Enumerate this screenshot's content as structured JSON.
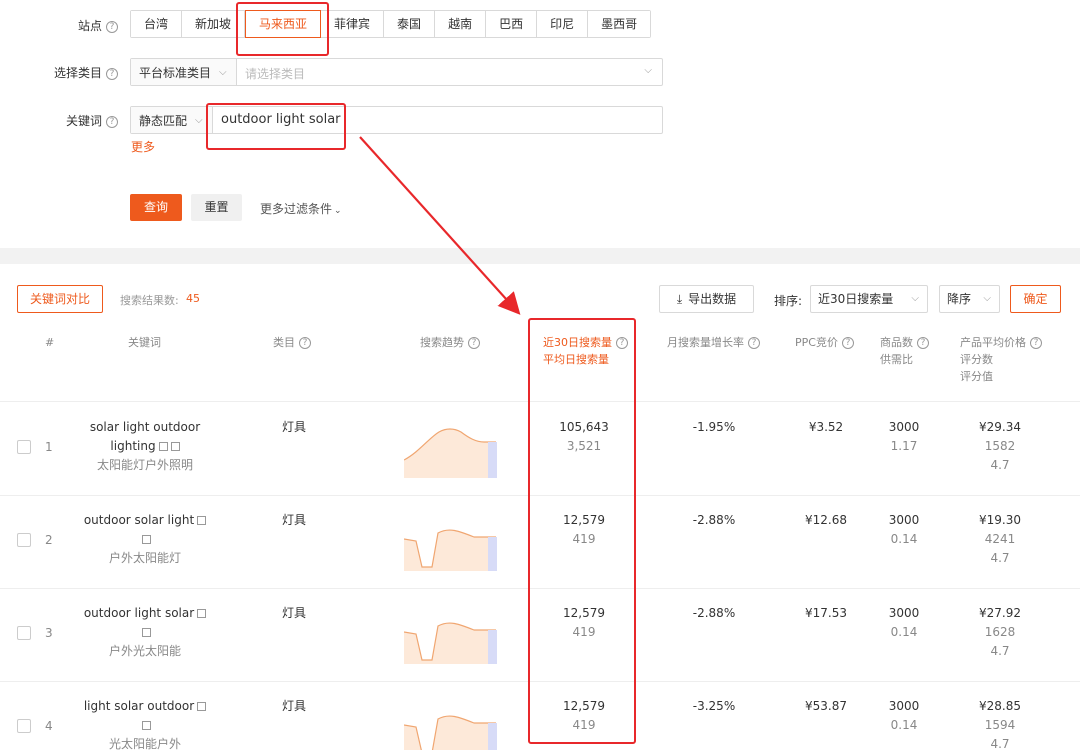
{
  "filters": {
    "site_label": "站点",
    "sites": [
      "台湾",
      "新加坡",
      "马来西亚",
      "菲律宾",
      "泰国",
      "越南",
      "巴西",
      "印尼",
      "墨西哥"
    ],
    "active_site": 2,
    "category_label": "选择类目",
    "category_type": "平台标准类目",
    "category_placeholder": "请选择类目",
    "keyword_label": "关键词",
    "match_type": "静态匹配",
    "keyword_value": "outdoor light solar",
    "more_label": "更多",
    "query_btn": "查询",
    "reset_btn": "重置",
    "more_filters": "更多过滤条件"
  },
  "toolbar": {
    "compare_btn": "关键词对比",
    "result_count_label": "搜索结果数:",
    "result_count": "45",
    "export_btn": "导出数据",
    "sort_label": "排序:",
    "sort_value": "近30日搜索量",
    "order_value": "降序",
    "confirm_btn": "确定"
  },
  "table": {
    "headers": {
      "num": "#",
      "keyword": "关键词",
      "category": "类目",
      "trend": "搜索趋势",
      "search30": "近30日搜索量",
      "search_daily": "平均日搜索量",
      "growth": "月搜索量增长率",
      "ppc": "PPC竞价",
      "products": "商品数",
      "supply_ratio": "供需比",
      "avg_price": "产品平均价格",
      "reviews": "评分数",
      "rating": "评分值"
    },
    "rows": [
      {
        "idx": "1",
        "kw1": "solar light outdoor",
        "kw2": "lighting",
        "cn": "太阳能灯户外照明",
        "cat": "灯具",
        "s30": "105,643",
        "daily": "3,521",
        "growth": "-1.95%",
        "ppc": "¥3.52",
        "products": "3000",
        "ratio": "1.17",
        "price": "¥29.34",
        "reviews": "1582",
        "rating": "4.7"
      },
      {
        "idx": "2",
        "kw1": "outdoor solar light",
        "kw2": "",
        "cn": "户外太阳能灯",
        "cat": "灯具",
        "s30": "12,579",
        "daily": "419",
        "growth": "-2.88%",
        "ppc": "¥12.68",
        "products": "3000",
        "ratio": "0.14",
        "price": "¥19.30",
        "reviews": "4241",
        "rating": "4.7"
      },
      {
        "idx": "3",
        "kw1": "outdoor light solar",
        "kw2": "",
        "cn": "户外光太阳能",
        "cat": "灯具",
        "s30": "12,579",
        "daily": "419",
        "growth": "-2.88%",
        "ppc": "¥17.53",
        "products": "3000",
        "ratio": "0.14",
        "price": "¥27.92",
        "reviews": "1628",
        "rating": "4.7"
      },
      {
        "idx": "4",
        "kw1": "light solar outdoor",
        "kw2": "",
        "cn": "光太阳能户外",
        "cat": "灯具",
        "s30": "12,579",
        "daily": "419",
        "growth": "-3.25%",
        "ppc": "¥53.87",
        "products": "3000",
        "ratio": "0.14",
        "price": "¥28.85",
        "reviews": "1594",
        "rating": "4.7"
      }
    ]
  },
  "colors": {
    "accent": "#ee5a1d",
    "annotation": "#e8282b",
    "trend_fill": "#fde9d9",
    "trend_line": "#f0a671"
  }
}
